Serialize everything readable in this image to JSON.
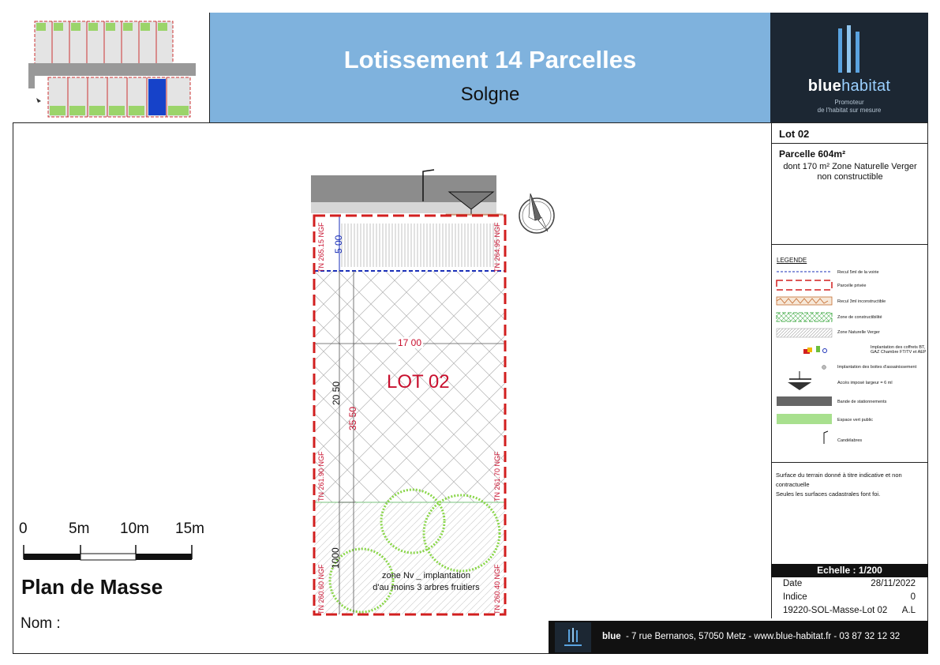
{
  "header": {
    "title": "Lotissement  14 Parcelles",
    "subtitle": "Solgne"
  },
  "logo": {
    "brand_bold": "blue",
    "brand_light": "habitat",
    "tagline_1": "Promoteur",
    "tagline_2": "de l'habitat sur mesure"
  },
  "lot": {
    "label": "Lot  02",
    "parcel": "Parcelle 604m²",
    "zone_line_1": "dont 170 m² Zone Naturelle Verger",
    "zone_line_2": "non constructible"
  },
  "plan": {
    "lot_label": "LOT 02",
    "width_dim": "17 00",
    "depth_total_dim": "35 50",
    "depth_build_dim": "20 50",
    "recul_dim": "5 00",
    "verger_dim": "1000",
    "tn_top_left": "TN 265.15 NGF",
    "tn_top_right": "TN 264.95 NGF",
    "tn_mid_left": "TN 261.90 NGF",
    "tn_mid_right": "TN 261.70 NGF",
    "tn_bot_left": "TN 260.60 NGF",
    "tn_bot_right": "TN 260.40 NGF",
    "zone_nv_1": "zone Nv _ implantation",
    "zone_nv_2": "d'au moins 3 arbres fruitiers"
  },
  "legend": {
    "title": "LEGENDE",
    "items": [
      "Recul 5ml de la voirie",
      "Parcelle privée",
      "Recul 3ml inconstructible",
      "Zone de constructibilité",
      "Zone Naturelle Verger",
      "Implantation des coffrets BT, GAZ Chambre FT/TV et AEP",
      "Implantation des boites d'assainissement",
      "Accès imposé largeur = 6 ml",
      "Bande de stationnements",
      "Espace vert public",
      "Candélabres"
    ]
  },
  "notes": {
    "line_1": "Surface du terrain donné à titre indicative et non contractuelle",
    "line_2": "Seules les surfaces cadastrales font foi."
  },
  "scale": {
    "echelle": "Echelle : 1/200",
    "labels": [
      "0",
      "5m",
      "10m",
      "15m"
    ]
  },
  "info": {
    "date_label": "Date",
    "date_value": "28/11/2022",
    "indice_label": "Indice",
    "indice_value": "0",
    "ref_label": "19220-SOL-Masse-Lot 02",
    "ref_value": "A.L"
  },
  "bottom": {
    "plan_title": "Plan de Masse",
    "nom_label": "Nom :"
  },
  "footer": {
    "brand": "blue",
    "address": "- 7 rue Bernanos, 57050 Metz - www.blue-habitat.fr - 03 87 32 12 32"
  },
  "colors": {
    "banner": "#7fb2dd",
    "logo_bg": "#1c2733",
    "parcel_red": "#d21f1f",
    "recul_blue": "#1a2fb8",
    "verger_green": "#8ad64a",
    "road_grey": "#8c8c8c"
  }
}
